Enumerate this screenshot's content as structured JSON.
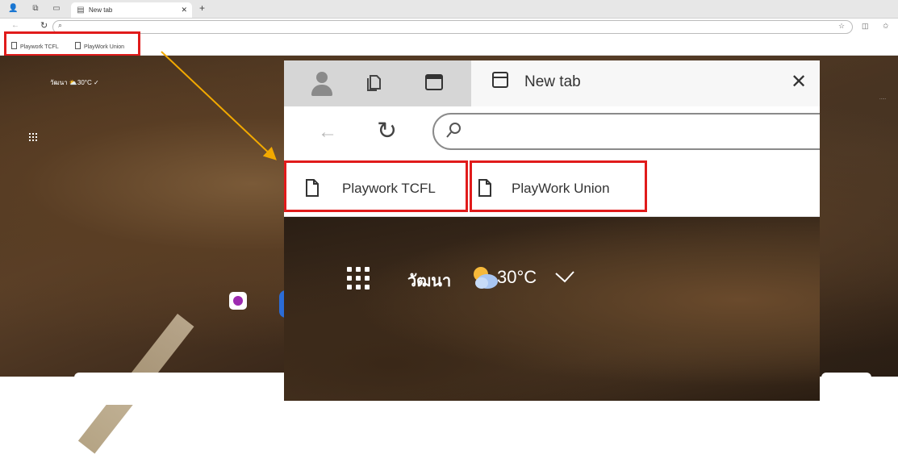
{
  "background_window": {
    "tab_title": "New tab",
    "favorites": [
      {
        "label": "Playwork TCFL"
      },
      {
        "label": "PlayWork Union"
      }
    ],
    "weather_city": "วัฒนา",
    "weather_temp": "30°C"
  },
  "zoom": {
    "tab_title": "New tab",
    "address_placeholder": "",
    "favorites": [
      {
        "label": "Playwork TCFL"
      },
      {
        "label": "PlayWork Union"
      }
    ],
    "weather": {
      "city": "วัฒนา",
      "temp": "30°C"
    }
  },
  "colors": {
    "highlight": "#e01b1b",
    "arrow": "#f2a900",
    "tile_accent": "#9d2bb0"
  }
}
